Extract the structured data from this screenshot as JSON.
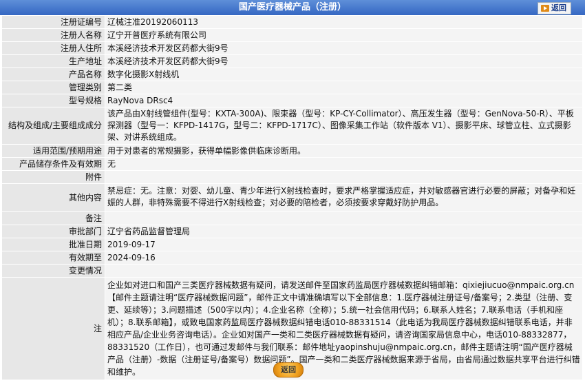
{
  "header": {
    "title": "国产医疗器械产品（注册）",
    "back_label": "返回"
  },
  "fields": [
    {
      "label": "注册证编号",
      "value": "辽械注准20192060113"
    },
    {
      "label": "注册人名称",
      "value": "辽宁开普医疗系统有限公司"
    },
    {
      "label": "注册人住所",
      "value": "本溪经济技术开发区药都大街9号"
    },
    {
      "label": "生产地址",
      "value": "本溪经济技术开发区药都大街9号"
    },
    {
      "label": "产品名称",
      "value": "数字化摄影X射线机"
    },
    {
      "label": "管理类别",
      "value": "第二类"
    },
    {
      "label": "型号规格",
      "value": "RayNova DRsc4"
    },
    {
      "label": "结构及组成/主要组成成分",
      "value": "该产品由X射线管组件(型号：KXTA-300A)、限束器（型号：KP-CY-Collimator）、高压发生器（型号：GenNova-50-R）、平板探测器（型号一：KFPD-1417G，型号二：KFPD-1717C）、图像采集工作站（软件版本 V1）、摄影平床、球管立柱、立式摄影架、对讲系统组成。"
    },
    {
      "label": "适用范围/预期用途",
      "value": "用于对患者的常规摄影，获得单幅影像供临床诊断用。"
    },
    {
      "label": "产品储存条件及有效期",
      "value": "无"
    },
    {
      "label": "附件",
      "value": ""
    },
    {
      "label": "其他内容",
      "value": "禁忌症：无。注意：对婴、幼儿童、青少年进行X射线检查时，要求严格掌握适应症，并对敏感器官进行必要的屏蔽；对备孕和妊娠的人群，非特殊需要不得进行X射线检查；对必要的陪检者，必须按要求穿戴好防护用品。"
    },
    {
      "label": "备注",
      "value": ""
    },
    {
      "label": "审批部门",
      "value": "辽宁省药品监督管理局"
    },
    {
      "label": "批准日期",
      "value": "2019-09-17"
    },
    {
      "label": "有效期至",
      "value": "2024-09-16"
    },
    {
      "label": "变更情况",
      "value": ""
    },
    {
      "label": "注",
      "value": "企业如对进口和国产三类医疗器械数据有疑问，请发送邮件至国家药监局医疗器械数据纠错邮箱：qixiejiucuo@nmpaic.org.cn【邮件主题请注明“医疗器械数据问题”，邮件正文中请准确填写以下全部信息：1.医疗器械注册证号/备案号；2.类型（注册、变更、延续等）；3.问题描述（500字以内）；4.企业名称（全称）；5.统一社会信用代码；6.联系人姓名；7.联系电话（手机和座机）；8.联系邮箱】，或致电国家药监局医疗器械数据纠错电话010-88331514（此电话为我局医疗器械数据纠错联系电话，并非相应产品/企业业务咨询电话）。企业如对国产一类和二类医疗器械数据有疑问，请咨询国家局信息中心，电话010-88332877，88331520（工作日），也可通过发邮件与我们联系：邮件地址yaopinshuju@nmpaic.org.cn，邮件主题请注明“国产医疗器械产品（注册）-数据（注册证号/备案号）数据问题”。国产一类和二类医疗器械数据来源于省局，由省局通过数据共享平台进行纠错和维护。"
    }
  ],
  "footer": {
    "back_label": "返回"
  }
}
